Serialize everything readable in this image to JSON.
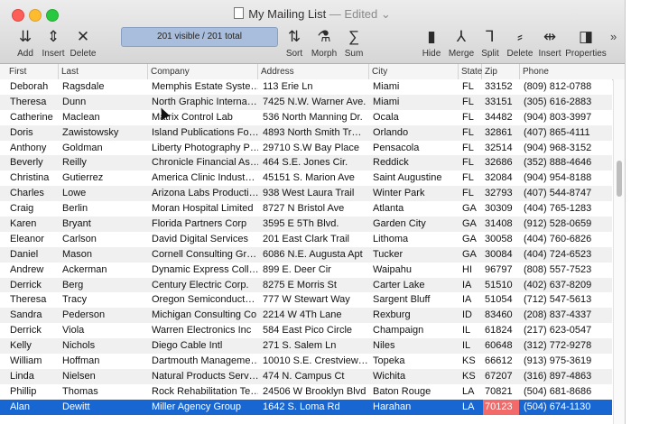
{
  "window": {
    "title": "My Mailing List",
    "edited": " — Edited ⌄"
  },
  "toolbar": {
    "left": [
      {
        "label": "Add",
        "icon": "⇊"
      },
      {
        "label": "Insert",
        "icon": "⇕"
      },
      {
        "label": "Delete",
        "icon": "✕"
      }
    ],
    "status": "201 visible / 201 total",
    "middle": [
      {
        "label": "Sort",
        "icon": "⇅"
      },
      {
        "label": "Morph",
        "icon": "⚗"
      },
      {
        "label": "Sum",
        "icon": "∑"
      }
    ],
    "right": [
      {
        "label": "Hide",
        "icon": "▮"
      },
      {
        "label": "Merge",
        "icon": "⅄"
      },
      {
        "label": "Split",
        "icon": "⅂"
      },
      {
        "label": "Delete",
        "icon": "⸗"
      },
      {
        "label": "Insert",
        "icon": "⇹"
      },
      {
        "label": "Properties",
        "icon": "◨"
      }
    ],
    "more": "»"
  },
  "columns": [
    "First",
    "Last",
    "Company",
    "Address",
    "City",
    "State",
    "Zip",
    "Phone"
  ],
  "rows": [
    [
      "Deborah",
      "Ragsdale",
      "Memphis Estate Syste…",
      "113 Erie Ln",
      "Miami",
      "FL",
      "33152",
      "(809) 812-0788"
    ],
    [
      "Theresa",
      "Dunn",
      "North Graphic Interna…",
      "7425 N.W. Warner Ave.",
      "Miami",
      "FL",
      "33151",
      "(305) 616-2883"
    ],
    [
      "Catherine",
      "Maclean",
      "Matrix Control Lab",
      "536 North Manning Dr.",
      "Ocala",
      "FL",
      "34482",
      "(904) 803-3997"
    ],
    [
      "Doris",
      "Zawistowsky",
      "Island Publications Fo…",
      "4893 North Smith Tr…",
      "Orlando",
      "FL",
      "32861",
      "(407) 865-4111"
    ],
    [
      "Anthony",
      "Goldman",
      "Liberty Photography P…",
      "29710 S.W Bay Place",
      "Pensacola",
      "FL",
      "32514",
      "(904) 968-3152"
    ],
    [
      "Beverly",
      "Reilly",
      "Chronicle Financial As…",
      "464 S.E. Jones Cir.",
      "Reddick",
      "FL",
      "32686",
      "(352) 888-4646"
    ],
    [
      "Christina",
      "Gutierrez",
      "America Clinic Indust…",
      "45151 S. Marion Ave",
      "Saint Augustine",
      "FL",
      "32084",
      "(904) 954-8188"
    ],
    [
      "Charles",
      "Lowe",
      "Arizona Labs Producti…",
      "938 West Laura Trail",
      "Winter Park",
      "FL",
      "32793",
      "(407) 544-8747"
    ],
    [
      "Craig",
      "Berlin",
      "Moran Hospital Limited",
      "8727 N Bristol Ave",
      "Atlanta",
      "GA",
      "30309",
      "(404) 765-1283"
    ],
    [
      "Karen",
      "Bryant",
      "Florida Partners Corp",
      "3595 E 5Th Blvd.",
      "Garden City",
      "GA",
      "31408",
      "(912) 528-0659"
    ],
    [
      "Eleanor",
      "Carlson",
      "David Digital Services",
      "201 East Clark Trail",
      "Lithoma",
      "GA",
      "30058",
      "(404) 760-6826"
    ],
    [
      "Daniel",
      "Mason",
      "Cornell Consulting Gr…",
      "6086 N.E. Augusta Apt",
      "Tucker",
      "GA",
      "30084",
      "(404) 724-6523"
    ],
    [
      "Andrew",
      "Ackerman",
      "Dynamic Express Coll…",
      "899 E. Deer Cir",
      "Waipahu",
      "HI",
      "96797",
      "(808) 557-7523"
    ],
    [
      "Derrick",
      "Berg",
      "Century Electric Corp.",
      "8275 E Morris St",
      "Carter Lake",
      "IA",
      "51510",
      "(402) 637-8209"
    ],
    [
      "Theresa",
      "Tracy",
      "Oregon Semiconduct…",
      "777 W Stewart Way",
      "Sargent Bluff",
      "IA",
      "51054",
      "(712) 547-5613"
    ],
    [
      "Sandra",
      "Pederson",
      "Michigan Consulting Co",
      "2214 W 4Th Lane",
      "Rexburg",
      "ID",
      "83460",
      "(208) 837-4337"
    ],
    [
      "Derrick",
      "Viola",
      "Warren Electronics Inc",
      "584 East Pico Circle",
      "Champaign",
      "IL",
      "61824",
      "(217) 623-0547"
    ],
    [
      "Kelly",
      "Nichols",
      "Diego Cable Intl",
      "271 S. Salem Ln",
      "Niles",
      "IL",
      "60648",
      "(312) 772-9278"
    ],
    [
      "William",
      "Hoffman",
      "Dartmouth Manageme…",
      "10010 S.E. Crestview…",
      "Topeka",
      "KS",
      "66612",
      "(913) 975-3619"
    ],
    [
      "Linda",
      "Nielsen",
      "Natural Products Serv…",
      "474 N. Campus Ct",
      "Wichita",
      "KS",
      "67207",
      "(316) 897-4863"
    ],
    [
      "Phillip",
      "Thomas",
      "Rock Rehabilitation Te…",
      "24506 W Brooklyn Blvd",
      "Baton Rouge",
      "LA",
      "70821",
      "(504) 681-8686"
    ],
    [
      "Alan",
      "Dewitt",
      "Miller Agency Group",
      "1642 S. Loma Rd",
      "Harahan",
      "LA",
      "70123",
      "(504) 674-1130"
    ]
  ],
  "selected_row": 21,
  "colors": {
    "selection": "#1766d1",
    "flag_cell": "#f26a6a",
    "status_field": "#a9bedc"
  }
}
